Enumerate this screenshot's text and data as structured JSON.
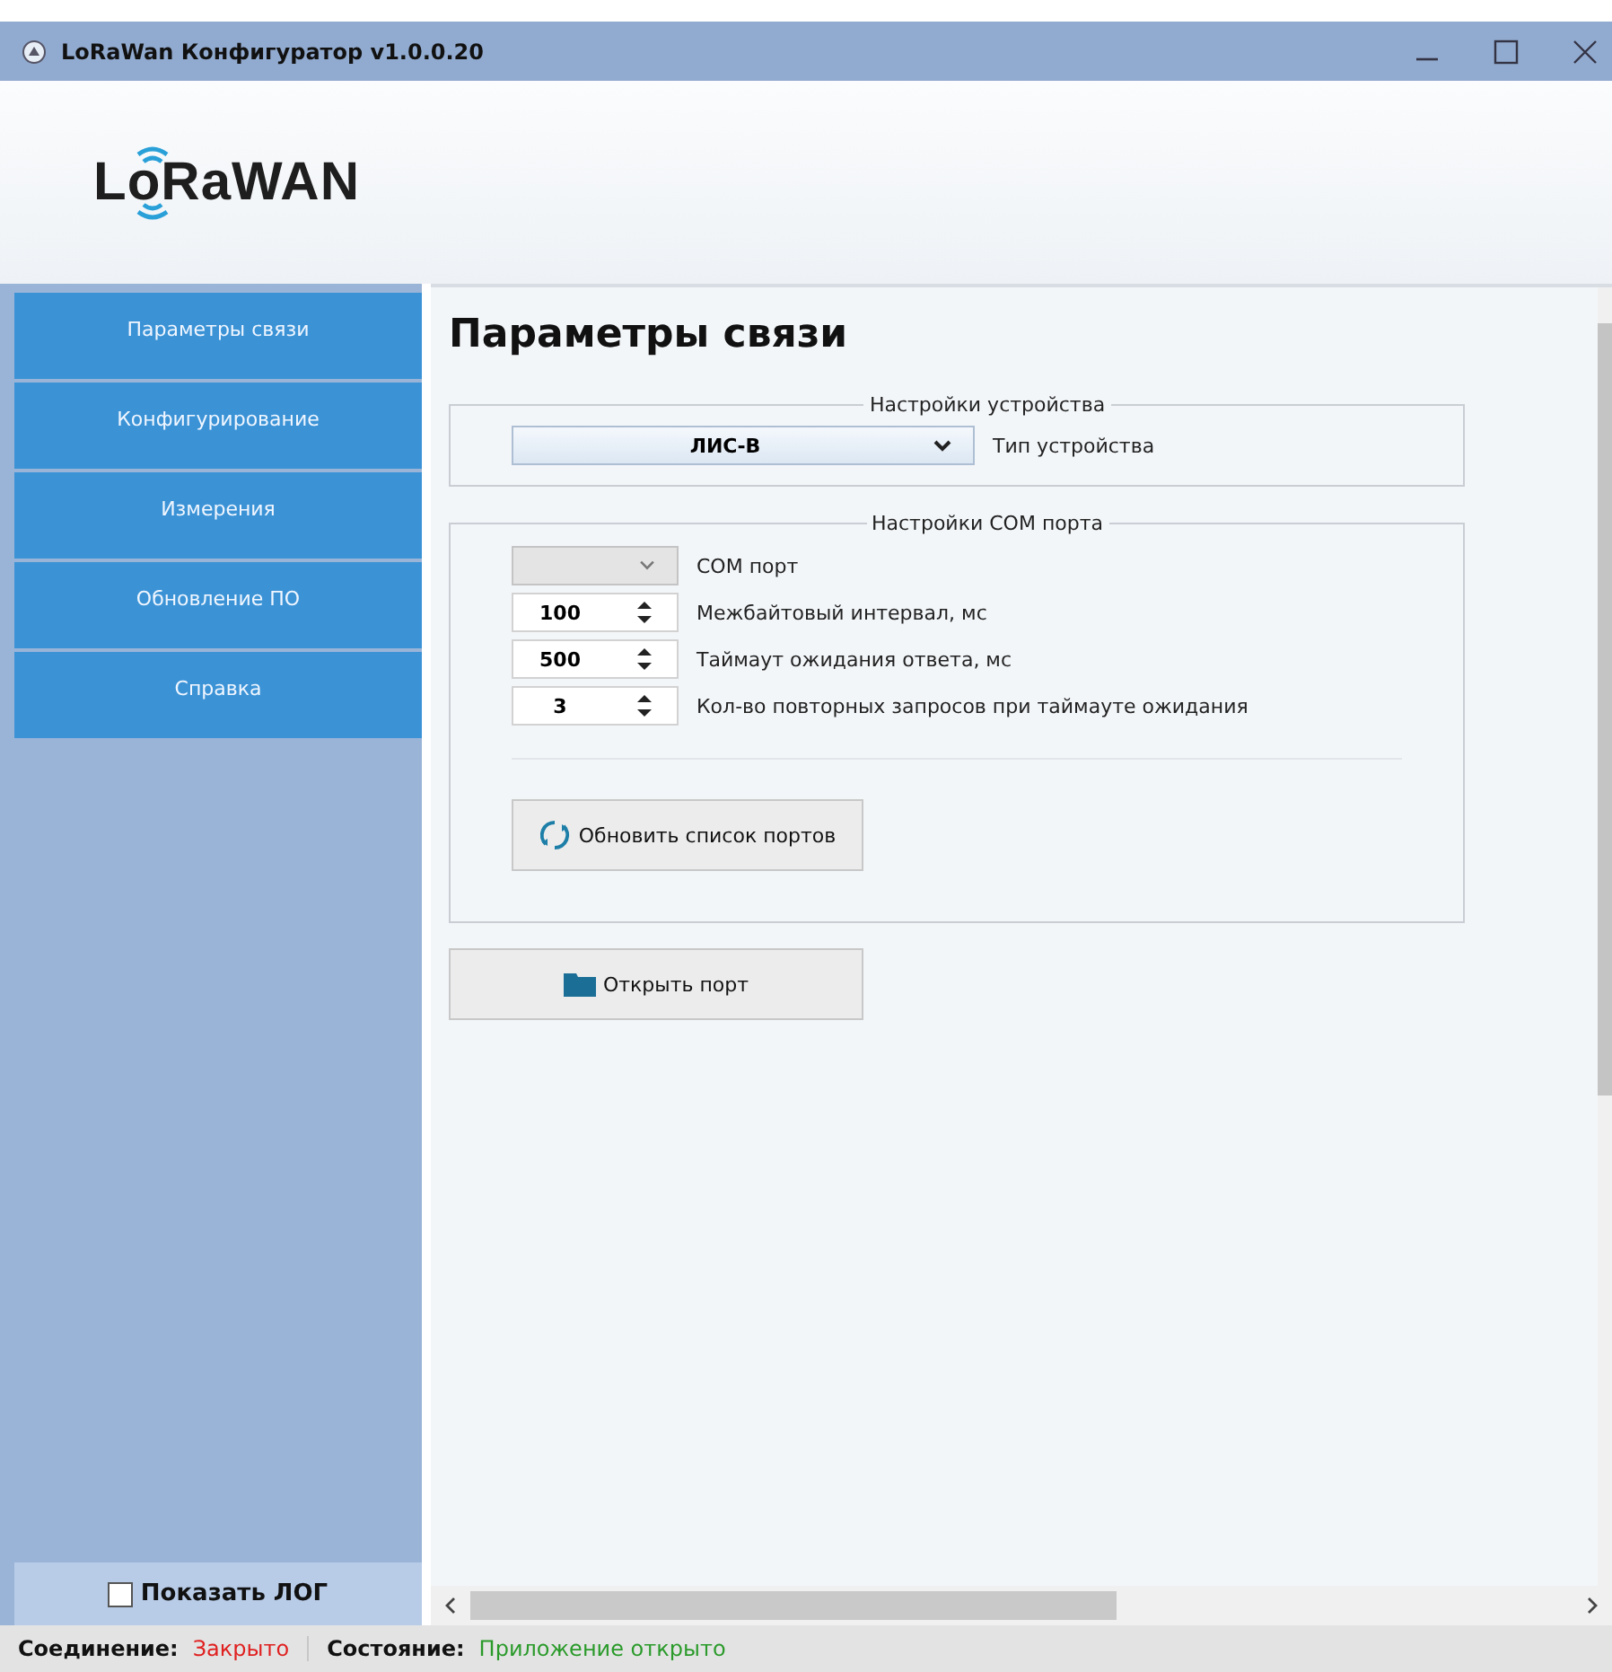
{
  "window": {
    "title": "LoRaWan Конфигуратор v1.0.0.20"
  },
  "logo": {
    "text": "LoRaWAN"
  },
  "sidebar": {
    "items": [
      {
        "label": "Параметры связи"
      },
      {
        "label": "Конфигурирование"
      },
      {
        "label": "Измерения"
      },
      {
        "label": "Обновление ПО"
      },
      {
        "label": "Справка"
      }
    ],
    "show_log": {
      "label": "Показать ЛОГ",
      "checked": false
    }
  },
  "page": {
    "heading": "Параметры связи",
    "device_group": {
      "title": "Настройки устройства",
      "device_type": {
        "value": "ЛИС-В",
        "label": "Тип устройства"
      }
    },
    "port_group": {
      "title": "Настройки COM порта",
      "fields": [
        {
          "kind": "dropdown",
          "label": "COM порт"
        },
        {
          "kind": "spin",
          "value": "100",
          "label": "Межбайтовый интервал, мс"
        },
        {
          "kind": "spin",
          "value": "500",
          "label": "Таймаут ожидания ответа, мс"
        },
        {
          "kind": "spin",
          "value": "3",
          "label": "Кол-во повторных запросов при таймауте ожидания"
        }
      ],
      "refresh_button": "Обновить список портов"
    },
    "open_button": "Открыть порт"
  },
  "status_bar": [
    {
      "label": "Соединение:",
      "value": "Закрыто",
      "color": "#e02020"
    },
    {
      "label": "Состояние:",
      "value": "Приложение открыто",
      "color": "#2a9a2a"
    }
  ]
}
